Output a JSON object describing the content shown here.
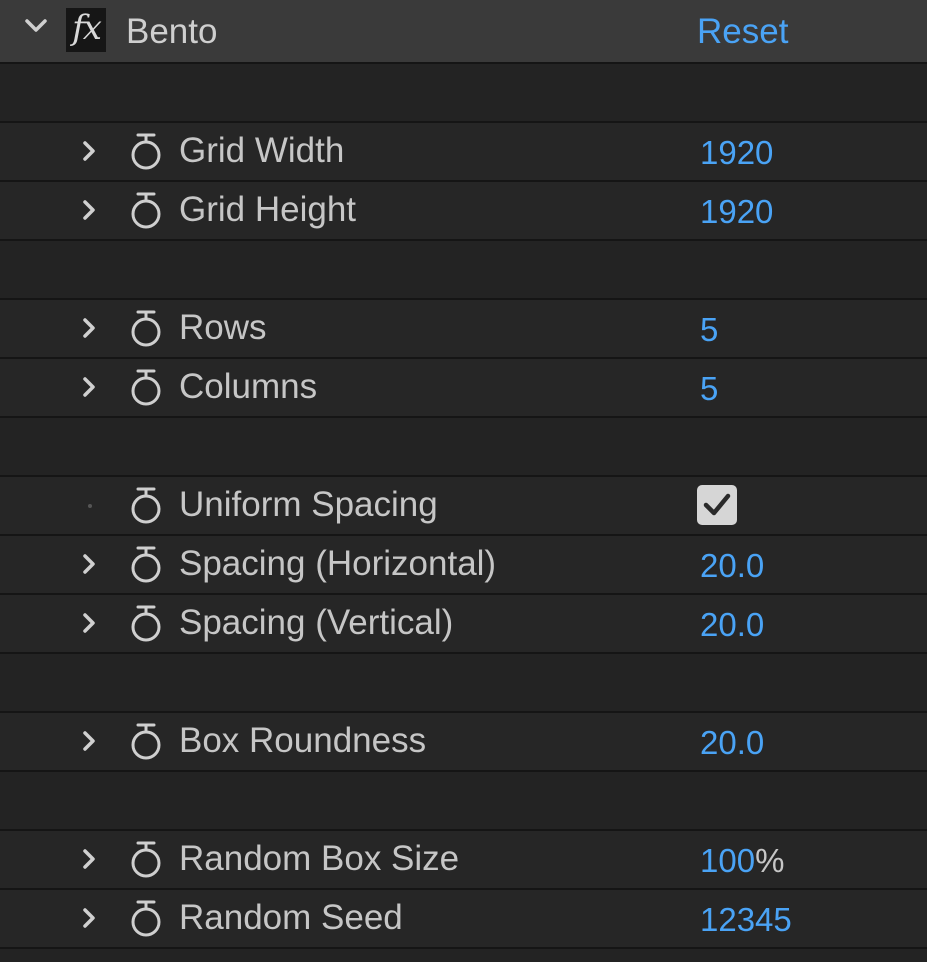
{
  "effect": {
    "name": "Bento",
    "fx_label": "fx",
    "reset_label": "Reset"
  },
  "properties": {
    "grid_width": {
      "label": "Grid Width",
      "value": "1920"
    },
    "grid_height": {
      "label": "Grid Height",
      "value": "1920"
    },
    "rows": {
      "label": "Rows",
      "value": "5"
    },
    "columns": {
      "label": "Columns",
      "value": "5"
    },
    "uniform_spacing": {
      "label": "Uniform Spacing",
      "checked": true
    },
    "spacing_h": {
      "label": "Spacing (Horizontal)",
      "value": "20.0"
    },
    "spacing_v": {
      "label": "Spacing (Vertical)",
      "value": "20.0"
    },
    "box_roundness": {
      "label": "Box Roundness",
      "value": "20.0"
    },
    "random_box_size": {
      "label": "Random Box Size",
      "value": "100",
      "unit": "%"
    },
    "random_seed": {
      "label": "Random Seed",
      "value": "12345"
    }
  },
  "icons": {
    "expand": "chevron-right-icon",
    "collapse": "chevron-down-icon",
    "stopwatch": "stopwatch-icon",
    "check": "checkmark-icon"
  },
  "colors": {
    "value_blue": "#4aa3f5",
    "background": "#232323",
    "header": "#3a3a3a"
  }
}
